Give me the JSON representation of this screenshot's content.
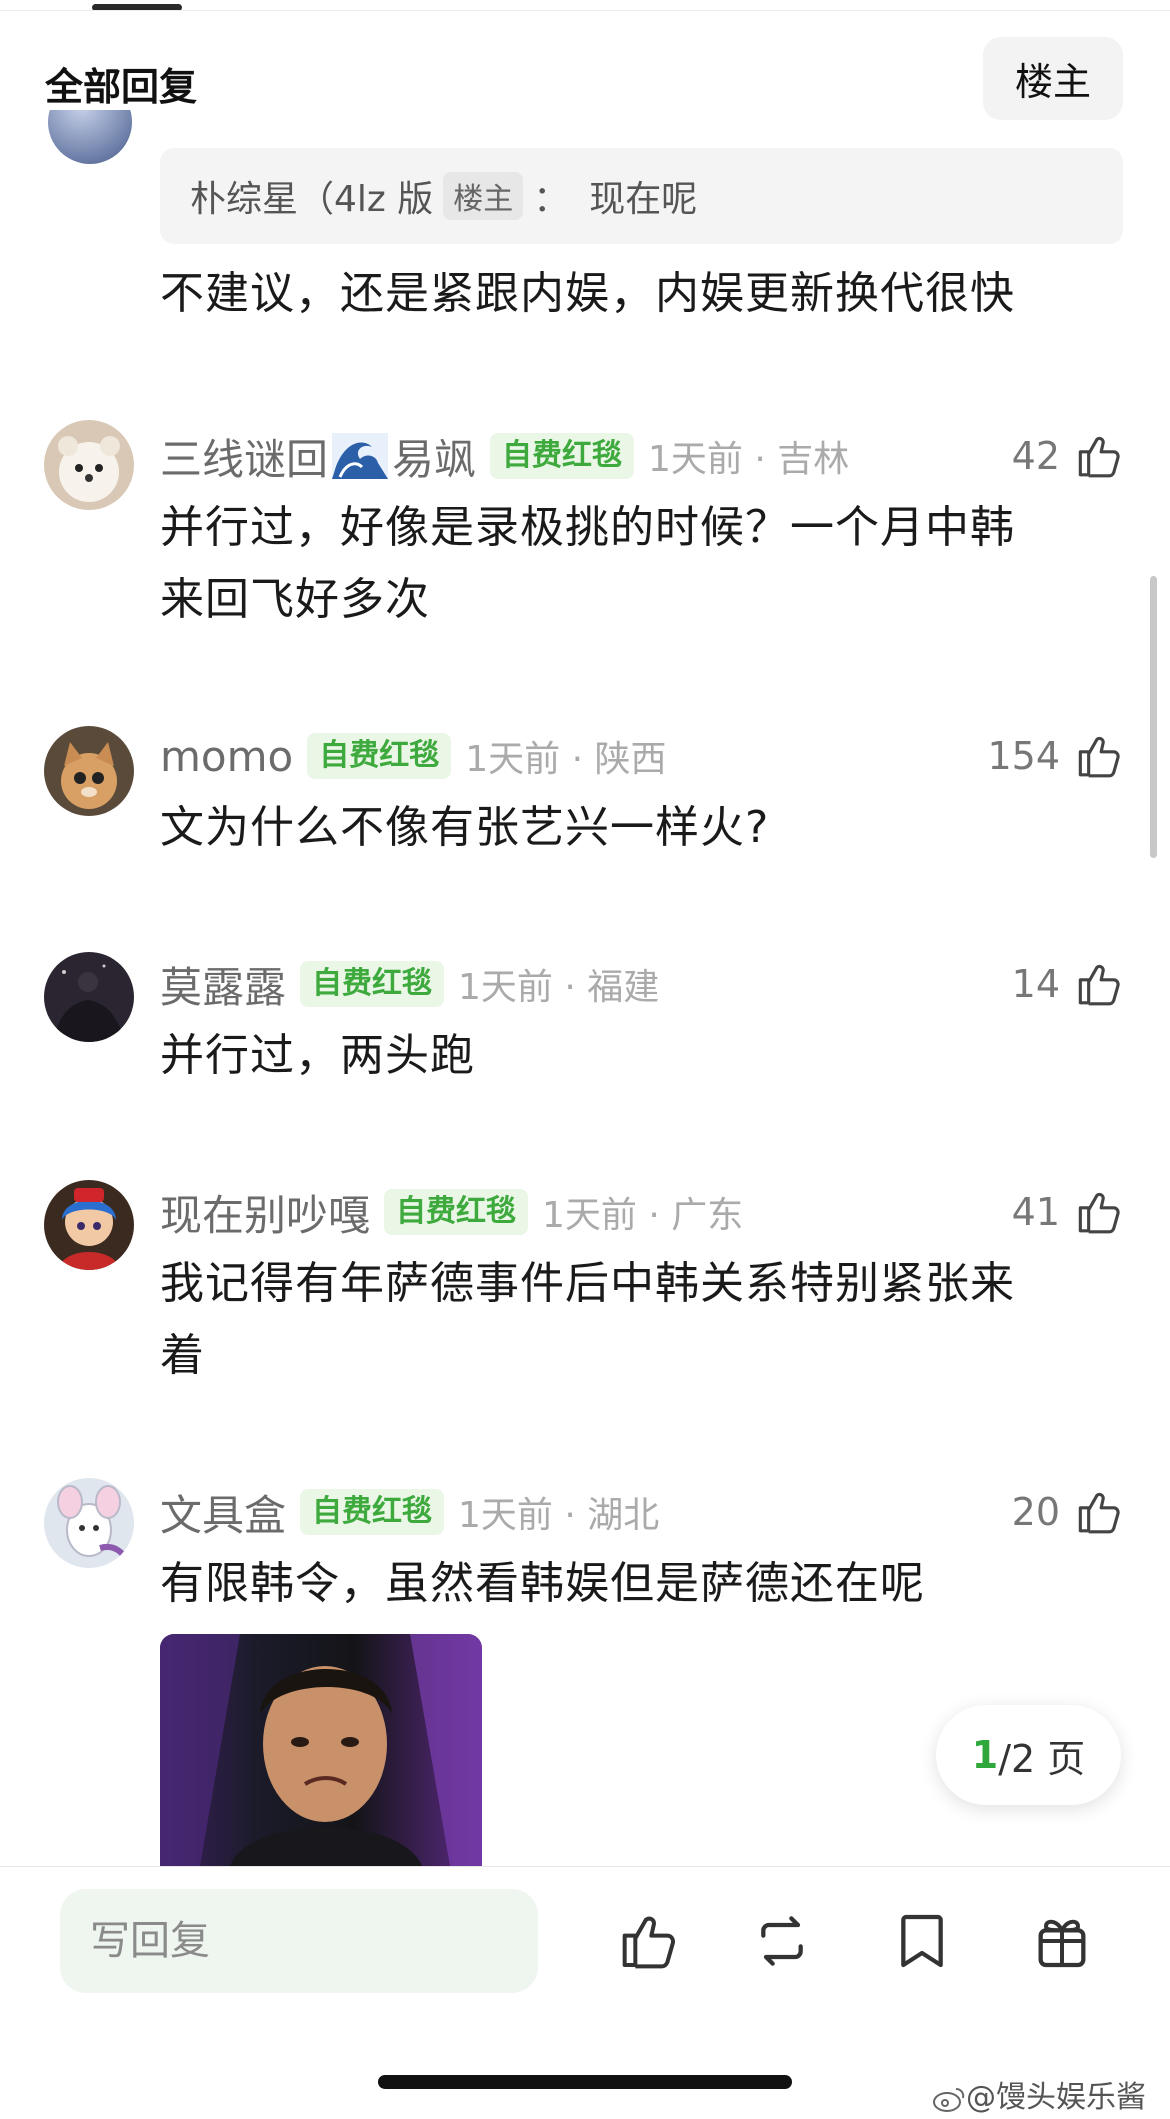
{
  "header": {
    "title": "全部回复",
    "op_button": "楼主"
  },
  "quote": {
    "author": "朴综星（4lz 版",
    "op_tag": "楼主",
    "separator": "：",
    "text": "现在呢"
  },
  "first_reply": {
    "text": "不建议，还是紧跟内娱，内娱更新换代很快"
  },
  "comments": [
    {
      "username_a": "三线谜回",
      "username_b": "易飒",
      "badge": "自费红毯",
      "time_location": "1天前 · 吉林",
      "likes": "42",
      "lines": [
        "并行过，好像是录极挑的时候？一个月中韩",
        "来回飞好多次"
      ]
    },
    {
      "username": "momo",
      "badge": "自费红毯",
      "time_location": "1天前 · 陕西",
      "likes": "154",
      "lines": [
        "文为什么不像有张艺兴一样火?"
      ]
    },
    {
      "username": "莫露露",
      "badge": "自费红毯",
      "time_location": "1天前 · 福建",
      "likes": "14",
      "lines": [
        "并行过，两头跑"
      ]
    },
    {
      "username": "现在别吵嘎",
      "badge": "自费红毯",
      "time_location": "1天前 · 广东",
      "likes": "41",
      "lines": [
        "我记得有年萨德事件后中韩关系特别紧张来",
        "着"
      ]
    },
    {
      "username": "文具盒",
      "badge": "自费红毯",
      "time_location": "1天前 · 湖北",
      "likes": "20",
      "lines": [
        "有限韩令，虽然看韩娱但是萨德还在呢"
      ]
    }
  ],
  "pagination": {
    "current": "1",
    "total": "/2 页"
  },
  "bottom_bar": {
    "reply_placeholder": "写回复"
  },
  "watermark": "@馒头娱乐酱",
  "colors": {
    "badge_green": "#3eaa3e",
    "badge_bg": "#eaf6e6",
    "input_bg": "#eef6ef"
  },
  "icons": [
    "like-icon",
    "repost-icon",
    "bookmark-icon",
    "gift-icon",
    "weibo-icon",
    "wave-emoji-icon"
  ]
}
